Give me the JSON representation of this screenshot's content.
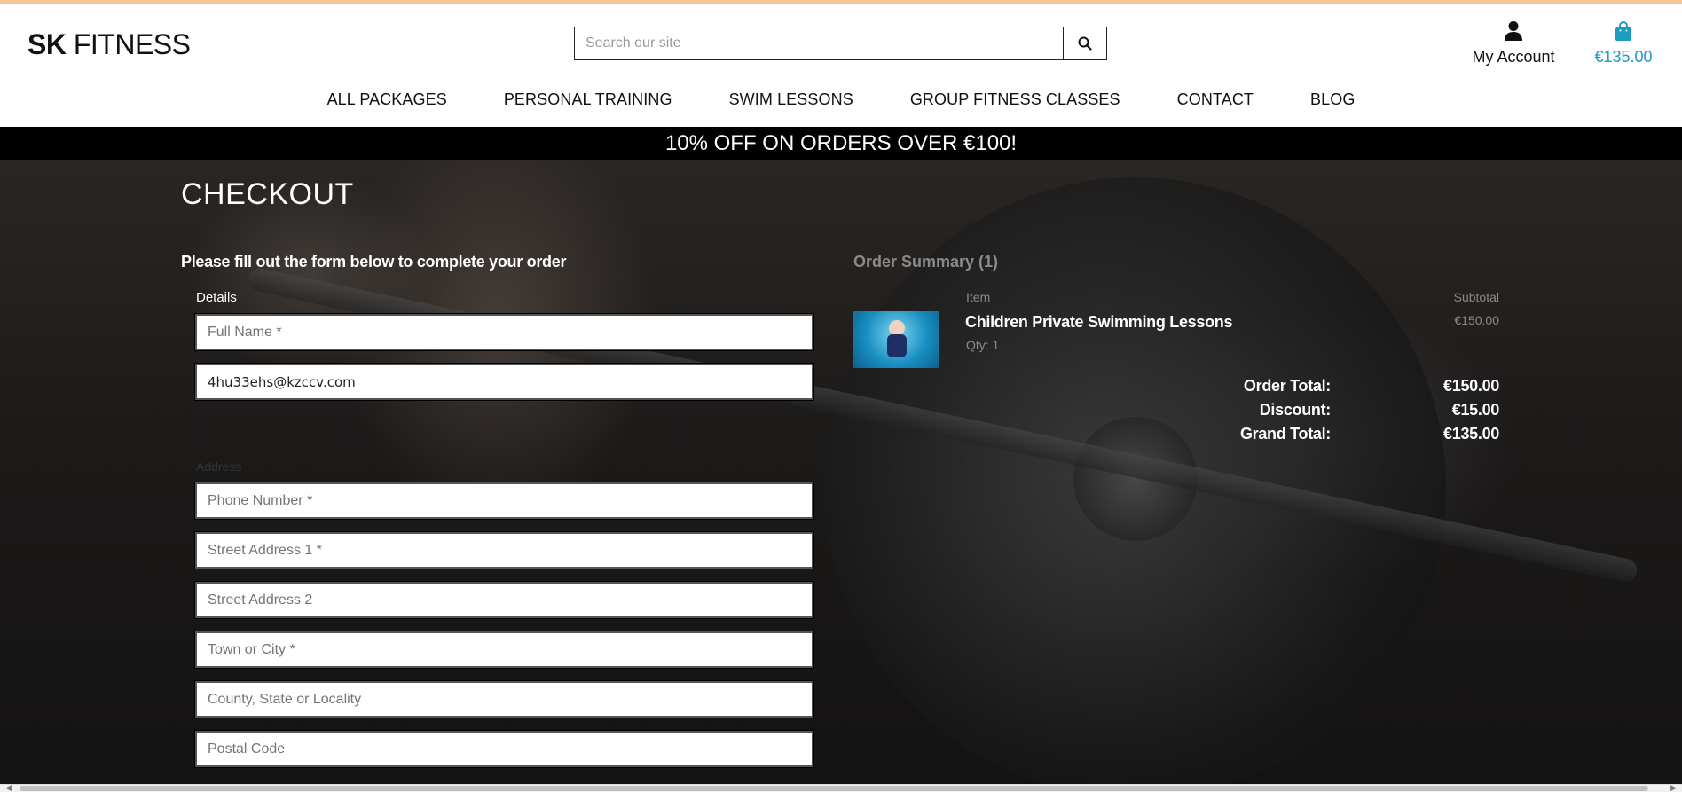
{
  "header": {
    "logo_bold": "SK",
    "logo_light": "FITNESS",
    "search": {
      "placeholder": "Search our site"
    },
    "account_label": "My Account",
    "cart_total": "€135.00"
  },
  "nav": {
    "items": [
      {
        "label": "ALL PACKAGES"
      },
      {
        "label": "PERSONAL TRAINING"
      },
      {
        "label": "SWIM LESSONS"
      },
      {
        "label": "GROUP FITNESS CLASSES"
      },
      {
        "label": "CONTACT"
      },
      {
        "label": "BLOG"
      }
    ]
  },
  "promo": {
    "text": "10% OFF ON ORDERS OVER €100!"
  },
  "checkout": {
    "title": "CHECKOUT",
    "intro": "Please fill out the form below to complete your order",
    "details_legend": "Details",
    "address_legend": "Address",
    "fields": {
      "full_name": {
        "placeholder": "Full Name *",
        "value": ""
      },
      "email": {
        "value": "4hu33ehs@kzccv.com"
      },
      "phone": {
        "placeholder": "Phone Number *"
      },
      "street1": {
        "placeholder": "Street Address 1 *"
      },
      "street2": {
        "placeholder": "Street Address 2"
      },
      "town": {
        "placeholder": "Town or City *"
      },
      "county": {
        "placeholder": "County, State or Locality"
      },
      "postcode": {
        "placeholder": "Postal Code"
      }
    }
  },
  "summary": {
    "title": "Order Summary (1)",
    "col_item": "Item",
    "col_subtotal": "Subtotal",
    "product": {
      "name": "Children Private Swimming Lessons",
      "qty": "Qty: 1",
      "subtotal": "€150.00"
    },
    "totals": [
      {
        "label": "Order Total:",
        "value": "€150.00"
      },
      {
        "label": "Discount:",
        "value": "€15.00"
      },
      {
        "label": "Grand Total:",
        "value": "€135.00"
      }
    ]
  },
  "colors": {
    "accent": "#1e9bc1",
    "promo_bg": "#000000",
    "top_strip": "#f5c69a"
  }
}
